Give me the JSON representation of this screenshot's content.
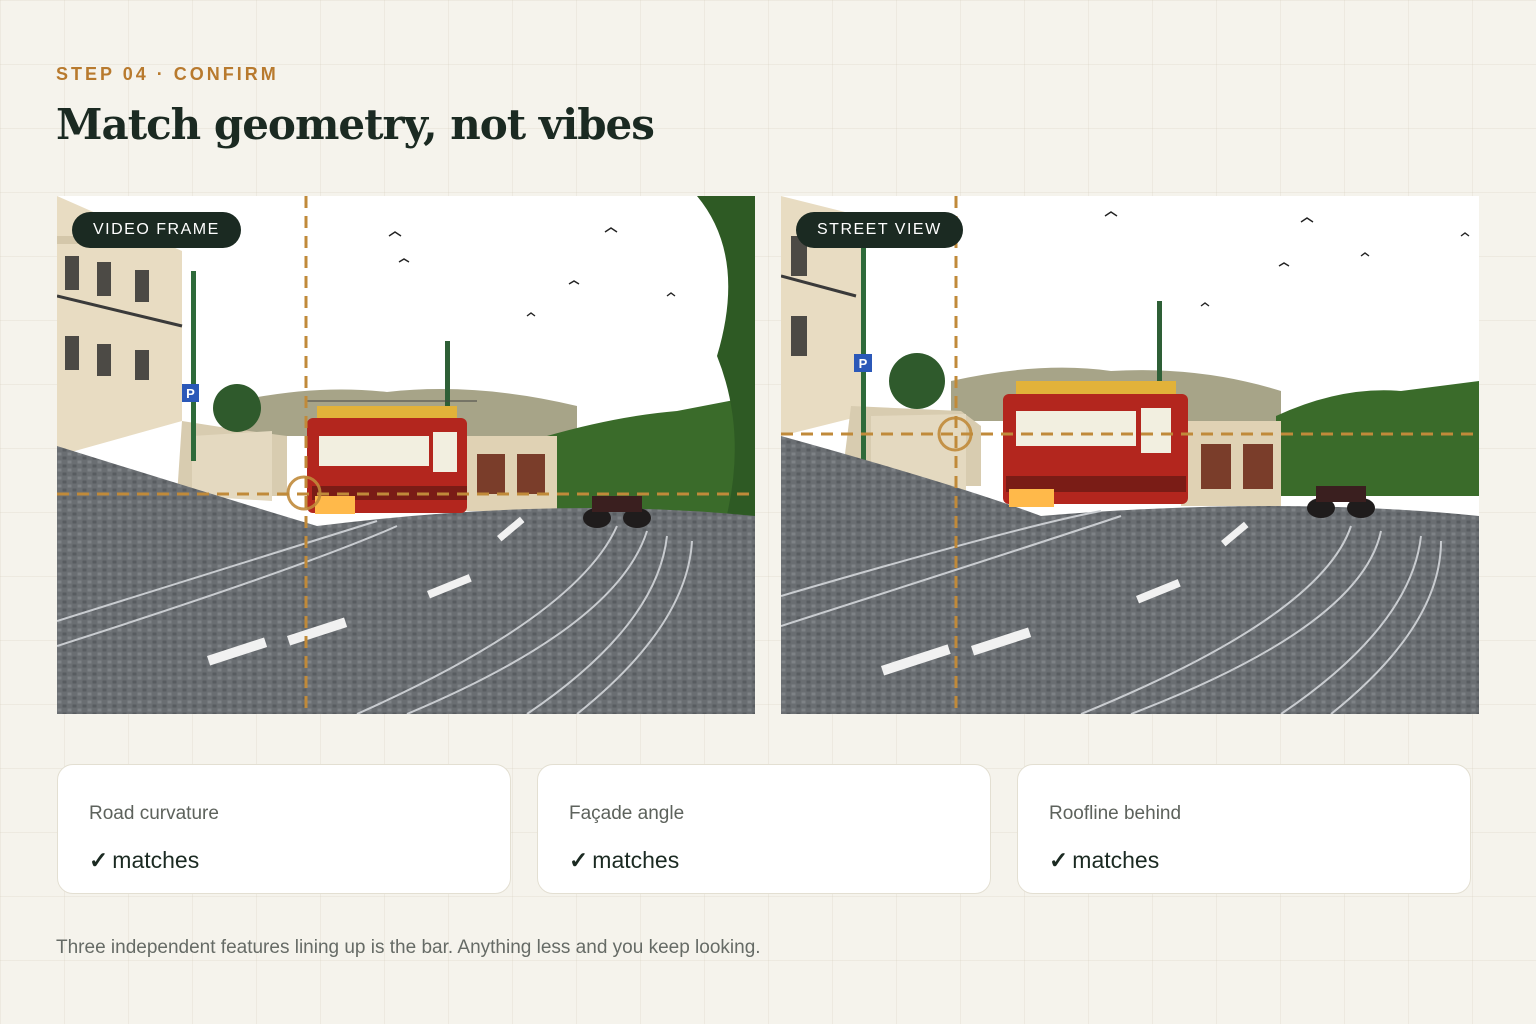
{
  "header": {
    "eyebrow": "STEP 04 · CONFIRM",
    "title": "Match geometry, not vibes"
  },
  "panels": [
    {
      "label": "VIDEO FRAME"
    },
    {
      "label": "STREET VIEW"
    }
  ],
  "parking_sign": "P",
  "checks": [
    {
      "label": "Road curvature",
      "status_icon": "✓",
      "value": "matches"
    },
    {
      "label": "Façade angle",
      "status_icon": "✓",
      "value": "matches"
    },
    {
      "label": "Roofline behind",
      "status_icon": "✓",
      "value": "matches"
    }
  ],
  "footnote": "Three independent features lining up is the bar. Anything less and you keep looking.",
  "colors": {
    "background": "#f5f3ec",
    "accent": "#b87a2e",
    "ink": "#1b2a22",
    "tram_red": "#b3261e"
  }
}
